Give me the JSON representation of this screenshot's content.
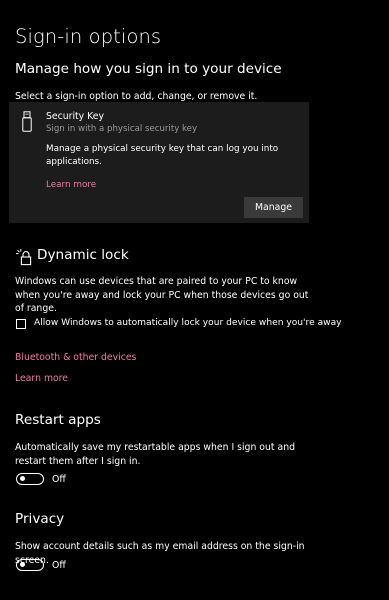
{
  "page": {
    "title": "Sign-in options"
  },
  "manage_section": {
    "heading": "Manage how you sign in to your device",
    "instruction": "Select a sign-in option to add, change, or remove it."
  },
  "security_key": {
    "icon": "usb-key-icon",
    "title": "Security Key",
    "subtitle": "Sign in with a physical security key",
    "description": "Manage a physical security key that can log you into applications.",
    "learn_more": "Learn more",
    "manage_button": "Manage"
  },
  "dynamic_lock": {
    "icon": "dynamic-lock-icon",
    "heading": "Dynamic lock",
    "description": "Windows can use devices that are paired to your PC to know when you're away and lock your PC when those devices go out of range.",
    "checkbox_label": "Allow Windows to automatically lock your device when you're away",
    "checkbox_checked": false,
    "bluetooth_link": "Bluetooth & other devices",
    "learn_more": "Learn more"
  },
  "restart_apps": {
    "heading": "Restart apps",
    "description": "Automatically save my restartable apps when I sign out and restart them after I sign in.",
    "toggle_state": "Off"
  },
  "privacy": {
    "heading": "Privacy",
    "description": "Show account details such as my email address on the sign-in screen.",
    "toggle_state": "Off"
  },
  "colors": {
    "background": "#000000",
    "card_background": "#1c1c1c",
    "accent_link": "#f27aa5",
    "button_background": "#3a3a3a",
    "secondary_text": "#9b9b9b"
  }
}
